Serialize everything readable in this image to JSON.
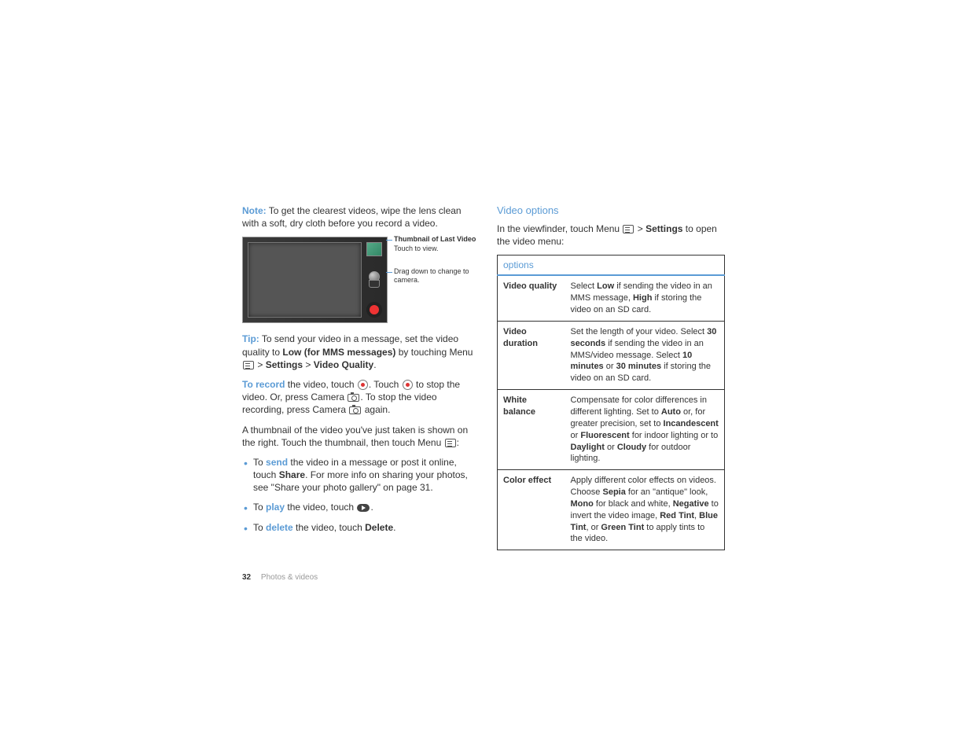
{
  "footer": {
    "page": "32",
    "section": "Photos & videos"
  },
  "left": {
    "note_label": "Note:",
    "note_text": " To get the clearest videos, wipe the lens clean with a soft, dry cloth before you record a video.",
    "callout1_title": "Thumbnail of Last Video",
    "callout1_sub": "Touch to view.",
    "callout2": "Drag down to change to camera.",
    "tip_label": "Tip:",
    "tip1": " To send your video in a message, set the video quality to ",
    "tip1b": "Low (for MMS messages)",
    "tip2": " by touching Menu ",
    "gt": " > ",
    "settings": "Settings",
    "vq": "Video Quality",
    "rec_label": "To record",
    "rec1": " the video, touch ",
    "rec2": ". Touch ",
    "rec3": " to stop the video. Or, press Camera ",
    "rec4": ". To stop the video recording, press Camera ",
    "rec5": " again.",
    "thumb_p": "A thumbnail of the video you've just taken is shown on the right. Touch the thumbnail, then touch Menu ",
    "colon": ":",
    "li1_to": "To ",
    "li1_a": "send",
    "li1_b": " the video in a message or post it online, touch ",
    "li1_share": "Share",
    "li1_c": ". For more info on sharing your photos, see \"Share your photo gallery\" on page 31.",
    "li2_to": "To ",
    "li2_a": "play",
    "li2_b": " the video, touch ",
    "li2_c": ".",
    "li3_to": "To ",
    "li3_a": "delete",
    "li3_b": " the video, touch ",
    "li3_del": "Delete",
    "li3_c": "."
  },
  "right": {
    "heading": "Video options",
    "intro1": "In the viewfinder, touch Menu ",
    "intro2": " to open the video menu:",
    "th": "options",
    "rows": [
      {
        "k": "Video quality",
        "pre": "Select ",
        "b1": "Low",
        "mid1": " if sending the video in an MMS message, ",
        "b2": "High",
        "mid2": " if storing the video on an SD card."
      },
      {
        "k": "Video duration",
        "pre": "Set the length of your video. Select ",
        "b1": "30 seconds",
        "mid1": " if sending the video in an MMS/video message. Select ",
        "b2": "10 minutes",
        "mid2": " or ",
        "b3": "30 minutes",
        "mid3": " if storing the video on an SD card."
      },
      {
        "k": "White balance",
        "pre": "Compensate for color differences in different lighting. Set to ",
        "b1": "Auto",
        "mid1": " or, for greater precision, set to ",
        "b2": "Incandescent",
        "mid2": " or ",
        "b3": "Fluorescent",
        "mid3": " for indoor lighting or to ",
        "b4": "Daylight",
        "mid4": " or ",
        "b5": "Cloudy",
        "mid5": " for outdoor lighting."
      },
      {
        "k": "Color effect",
        "pre": "Apply different color effects on videos. Choose ",
        "b1": "Sepia",
        "mid1": " for an \"antique\" look, ",
        "b2": "Mono",
        "mid2": " for black and white, ",
        "b3": "Negative",
        "mid3": " to invert the video image, ",
        "b4": "Red Tint",
        "mid4": ", ",
        "b5": "Blue Tint",
        "mid5": ", or ",
        "b6": "Green Tint",
        "mid6": " to apply tints to the video."
      }
    ]
  }
}
